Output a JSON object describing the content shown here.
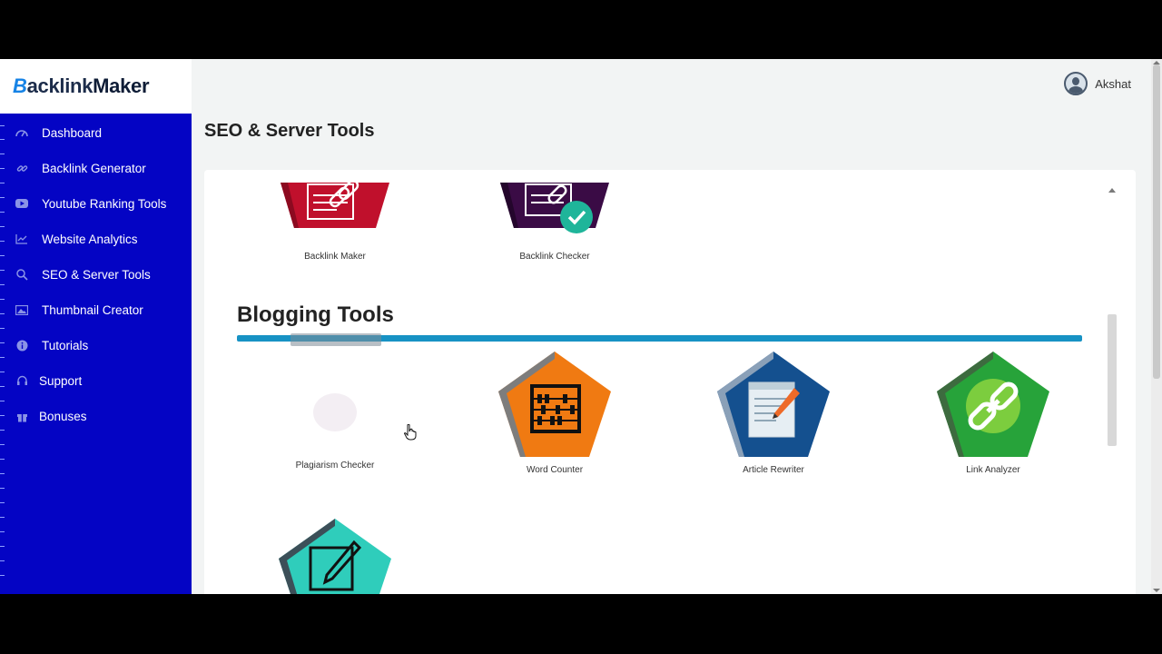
{
  "app": {
    "logo_prefix": "B",
    "logo_word": "acklink",
    "logo_suffix": "Maker"
  },
  "user": {
    "name": "Akshat",
    "avatar_icon": "user-avatar-icon"
  },
  "sidebar": {
    "items": [
      {
        "label": "Dashboard",
        "icon": "dashboard-icon"
      },
      {
        "label": "Backlink Generator",
        "icon": "link-icon"
      },
      {
        "label": "Youtube Ranking Tools",
        "icon": "youtube-icon"
      },
      {
        "label": "Website Analytics",
        "icon": "chart-line-icon"
      },
      {
        "label": "SEO & Server Tools",
        "icon": "search-icon"
      },
      {
        "label": "Thumbnail Creator",
        "icon": "image-icon"
      },
      {
        "label": "Tutorials",
        "icon": "info-icon"
      },
      {
        "label": "Support",
        "icon": "headset-icon"
      },
      {
        "label": "Bonuses",
        "icon": "gift-icon"
      }
    ]
  },
  "page": {
    "title": "SEO & Server Tools"
  },
  "seo_tools": [
    {
      "label": "Backlink Maker",
      "icon": "backlink-maker-icon",
      "color": "#c0102c"
    },
    {
      "label": "Backlink Checker",
      "icon": "backlink-checker-icon",
      "color": "#3a0b45"
    }
  ],
  "blogging": {
    "title": "Blogging Tools",
    "accent": "#1792c4",
    "tools": [
      {
        "label": "Plagiarism Checker",
        "icon": "plagiarism-checker-icon"
      },
      {
        "label": "Word Counter",
        "icon": "abacus-icon",
        "color": "#f07a12"
      },
      {
        "label": "Article Rewriter",
        "icon": "article-pen-icon",
        "color": "#14508f"
      },
      {
        "label": "Link Analyzer",
        "icon": "chain-link-icon",
        "color": "#27a33a"
      }
    ],
    "extra_tool_icon": "notepad-pencil-icon"
  }
}
